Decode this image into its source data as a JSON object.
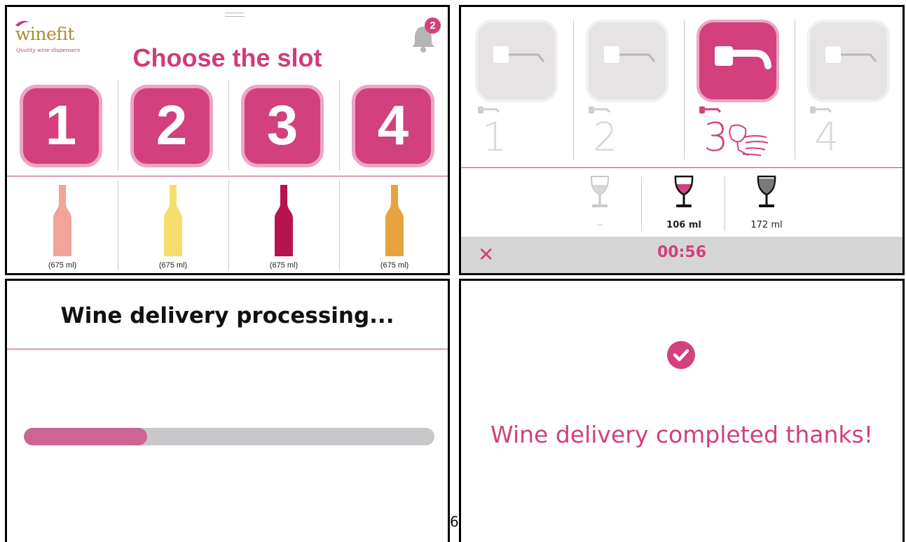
{
  "colors": {
    "accent": "#d2407d",
    "accent_light": "#eba6c6",
    "inactive_tile": "#e5e3e4",
    "footer_bar": "#d6d5d6",
    "progress_fill": "#cc6494",
    "progress_track": "#c8c8ca"
  },
  "choose_screen": {
    "logo_word": "winefit",
    "logo_tagline": "Quality wine dispensers",
    "notification_count": "2",
    "title": "Choose the slot",
    "slots": [
      {
        "number": "1",
        "bottle_label": "(675 ml)",
        "bottle_color": "#f2a49a"
      },
      {
        "number": "2",
        "bottle_label": "(675 ml)",
        "bottle_color": "#f4df6e"
      },
      {
        "number": "3",
        "bottle_label": "(675 ml)",
        "bottle_color": "#b8124f"
      },
      {
        "number": "4",
        "bottle_label": "(675 ml)",
        "bottle_color": "#e5a440"
      }
    ]
  },
  "dispense_screen": {
    "taps": [
      {
        "number": "1",
        "active": false
      },
      {
        "number": "2",
        "active": false
      },
      {
        "number": "3",
        "active": true
      },
      {
        "number": "4",
        "active": false
      }
    ],
    "glass_sizes": [
      {
        "label": "--",
        "state": "empty"
      },
      {
        "label": "106 ml",
        "state": "selected"
      },
      {
        "label": "172 ml",
        "state": "full"
      }
    ],
    "close_icon": "close-icon",
    "timer": "00:56"
  },
  "processing_screen": {
    "title": "Wine delivery processing...",
    "progress_fraction": 0.3,
    "stray_text": "6"
  },
  "completed_screen": {
    "icon": "check-circle-icon",
    "message": "Wine delivery completed thanks!"
  }
}
